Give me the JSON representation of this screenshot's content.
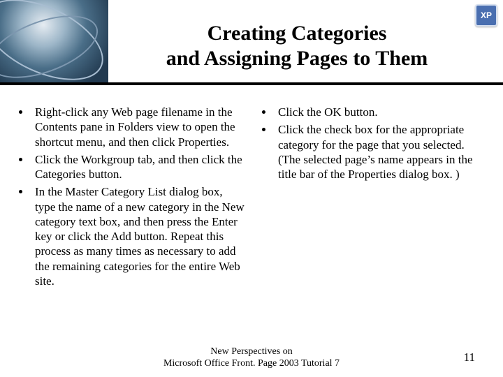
{
  "badge": "XP",
  "title_line1": "Creating Categories",
  "title_line2": "and Assigning Pages to Them",
  "left_bullets": [
    "Right-click any Web page filename in the Contents pane in Folders view to open the shortcut menu, and then click Properties.",
    "Click the Workgroup tab, and then click the Categories button.",
    "In the Master Category List dialog box, type the name of a new category in the New category text box, and then press the Enter key or click the Add button. Repeat this process as many times as necessary to add the remaining categories for the entire Web site."
  ],
  "right_bullets": [
    "Click the OK button.",
    "Click the check box for the appropriate category for the page that you selected. (The selected page’s name appears in the title bar of the Properties dialog box. )"
  ],
  "footer_line1": "New Perspectives on",
  "footer_line2": "Microsoft Office Front. Page 2003 Tutorial 7",
  "page_number": "11"
}
